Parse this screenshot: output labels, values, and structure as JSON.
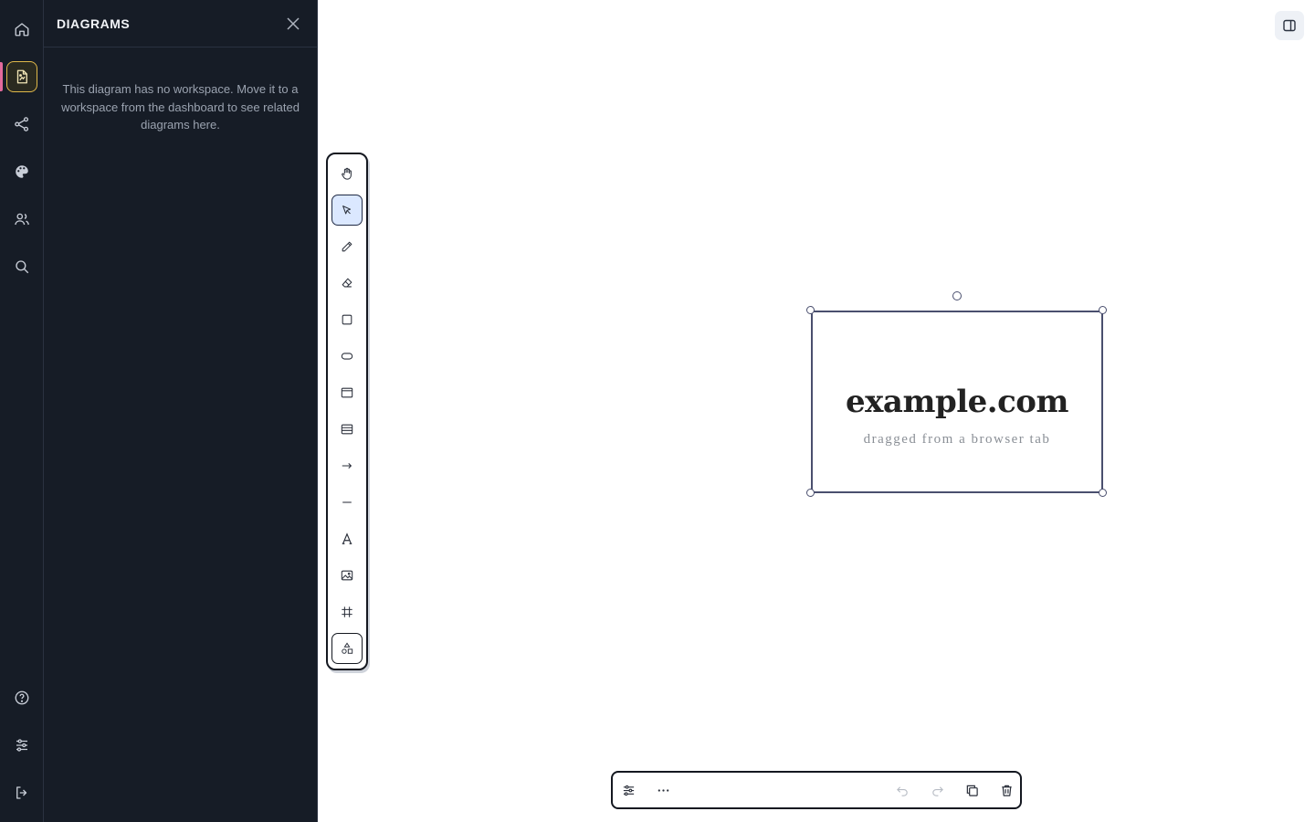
{
  "sidebar_panel": {
    "title": "DIAGRAMS",
    "empty_message": "This diagram has no workspace. Move it to a workspace from the dashboard to see related diagrams here."
  },
  "rail": {
    "items": [
      {
        "name": "home",
        "icon": "home-icon"
      },
      {
        "name": "diagrams",
        "icon": "diagram-file-icon",
        "active": true
      },
      {
        "name": "share",
        "icon": "share-icon"
      },
      {
        "name": "theme",
        "icon": "palette-icon"
      },
      {
        "name": "collaborators",
        "icon": "users-icon"
      },
      {
        "name": "search",
        "icon": "search-icon"
      },
      {
        "name": "help",
        "icon": "help-icon"
      },
      {
        "name": "preferences",
        "icon": "sliders-icon"
      },
      {
        "name": "logout",
        "icon": "logout-icon"
      }
    ],
    "active_accent": "#e0b84a",
    "indicator_color": "#e36a9c"
  },
  "tools": [
    {
      "name": "hand",
      "icon": "hand-icon"
    },
    {
      "name": "select",
      "icon": "pointer-icon",
      "selected": true
    },
    {
      "name": "pencil",
      "icon": "pencil-icon"
    },
    {
      "name": "eraser",
      "icon": "eraser-icon"
    },
    {
      "name": "rectangle",
      "icon": "square-icon"
    },
    {
      "name": "pill",
      "icon": "pill-icon"
    },
    {
      "name": "window",
      "icon": "browser-window-icon"
    },
    {
      "name": "table",
      "icon": "table-icon"
    },
    {
      "name": "arrow",
      "icon": "arrow-right-icon"
    },
    {
      "name": "line",
      "icon": "line-icon"
    },
    {
      "name": "text",
      "icon": "text-icon"
    },
    {
      "name": "image",
      "icon": "image-icon"
    },
    {
      "name": "frame",
      "icon": "frame-icon"
    },
    {
      "name": "shapes",
      "icon": "shapes-icon"
    }
  ],
  "canvas": {
    "card": {
      "title": "example.com",
      "subtitle": "dragged from a browser tab"
    }
  },
  "bottombar": {
    "actions": [
      {
        "name": "settings",
        "icon": "sliders-icon"
      },
      {
        "name": "more",
        "icon": "more-icon"
      },
      {
        "name": "undo",
        "icon": "undo-icon",
        "disabled": true
      },
      {
        "name": "redo",
        "icon": "redo-icon",
        "disabled": true
      },
      {
        "name": "duplicate",
        "icon": "copy-icon"
      },
      {
        "name": "delete",
        "icon": "trash-icon"
      }
    ]
  },
  "colors": {
    "rail_bg": "#161c26",
    "selection": "#4a4f6e",
    "selected_tool_bg": "#dbe8ff"
  }
}
